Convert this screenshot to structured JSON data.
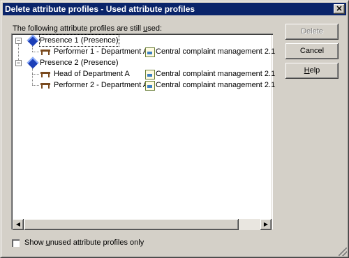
{
  "dialog": {
    "title": "Delete attribute profiles - Used attribute profiles",
    "close_symbol": "✕"
  },
  "caption": {
    "before": "The following attribute profiles are still ",
    "underlined": "u",
    "after": "sed:"
  },
  "tree": {
    "expander_symbol": "−",
    "presence_icon": "presence-icon",
    "performer_icon": "performer-icon",
    "document_icon": "document-icon",
    "groups": [
      {
        "label": "Presence 1 (Presence)",
        "children": [
          {
            "performer": "Performer 1 - Department A",
            "process": "Central complaint management 2.1"
          }
        ]
      },
      {
        "label": "Presence 2 (Presence)",
        "children": [
          {
            "performer": "Head of Department A",
            "process": "Central complaint management 2.1"
          },
          {
            "performer": "Performer 2 - Department A",
            "process": "Central complaint management 2.1"
          }
        ]
      }
    ]
  },
  "scrollbar": {
    "left_arrow": "◀",
    "right_arrow": "▶"
  },
  "buttons": {
    "delete": "Delete",
    "cancel": "Cancel",
    "help_underlined": "H",
    "help_rest": "elp"
  },
  "checkbox": {
    "before": "Show ",
    "underlined": "u",
    "after": "nused attribute profiles only",
    "checked": false
  }
}
